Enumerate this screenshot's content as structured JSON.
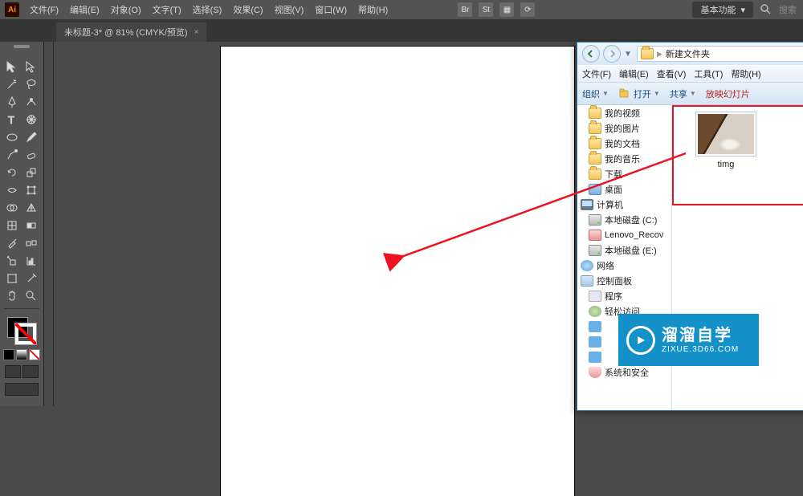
{
  "ai": {
    "logo": "Ai",
    "menu": [
      "文件(F)",
      "编辑(E)",
      "对象(O)",
      "文字(T)",
      "选择(S)",
      "效果(C)",
      "视图(V)",
      "窗口(W)",
      "帮助(H)"
    ],
    "right_icons": [
      "Br",
      "St"
    ],
    "workspace": "基本功能",
    "search_placeholder": "搜索",
    "tab_title": "未标题-3* @ 81% (CMYK/预览)",
    "tab_close": "×"
  },
  "explorer": {
    "path": {
      "root_icon": "folder",
      "segments": [
        "新建文件夹"
      ]
    },
    "menu": [
      "文件(F)",
      "编辑(E)",
      "查看(V)",
      "工具(T)",
      "帮助(H)"
    ],
    "toolbar": {
      "organize": "组织",
      "open": "打开",
      "share": "共享",
      "slideshow": "放映幻灯片"
    },
    "tree": [
      {
        "label": "我的视频",
        "icon": "folder"
      },
      {
        "label": "我的图片",
        "icon": "folder"
      },
      {
        "label": "我的文档",
        "icon": "folder"
      },
      {
        "label": "我的音乐",
        "icon": "folder"
      },
      {
        "label": "下载",
        "icon": "folder"
      },
      {
        "label": "桌面",
        "icon": "desktop"
      },
      {
        "label": "计算机",
        "icon": "computer"
      },
      {
        "label": "本地磁盘 (C:)",
        "icon": "drive"
      },
      {
        "label": "Lenovo_Recov",
        "icon": "lenovo"
      },
      {
        "label": "本地磁盘 (E:)",
        "icon": "drive"
      },
      {
        "label": "网络",
        "icon": "network"
      },
      {
        "label": "控制面板",
        "icon": "panel"
      },
      {
        "label": "程序",
        "icon": "prog"
      },
      {
        "label": "轻松访问",
        "icon": "gear"
      },
      {
        "label": "",
        "icon": "blue"
      },
      {
        "label": "",
        "icon": "blue"
      },
      {
        "label": "",
        "icon": "blue"
      },
      {
        "label": "系统和安全",
        "icon": "shield"
      }
    ],
    "file": {
      "name": "timg"
    }
  },
  "watermark": {
    "title": "溜溜自学",
    "url": "ZIXUE.3D66.COM"
  }
}
